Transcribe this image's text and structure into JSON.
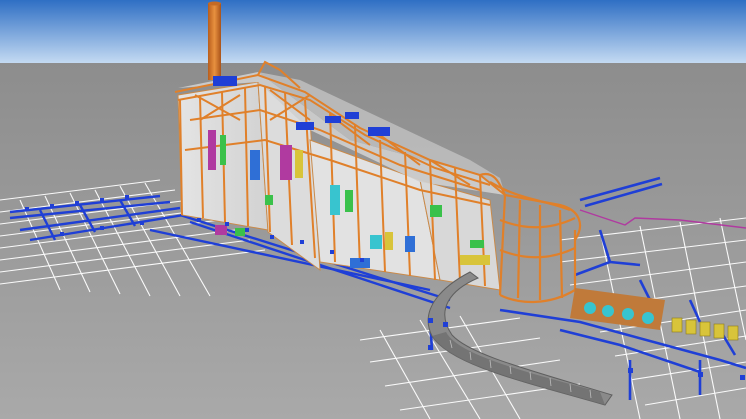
{
  "scene": {
    "sky_top": "#2f6fc4",
    "sky_bottom": "#b9d2ee",
    "ground": "#9c9c9c",
    "grid_line": "#ffffff",
    "pipe_blue": "#1f3fd6",
    "steel_orange": "#e0802a",
    "wall_white": "#ececec",
    "roof_grey": "#c9c9c9",
    "ramp_grey": "#7d7d7d",
    "stack_orange": "#d9772b",
    "duct_magenta": "#b03aa0",
    "tank_cyan": "#38c4cf",
    "yellow_equipment": "#d8c43a",
    "green_equipment": "#3ac14a"
  }
}
